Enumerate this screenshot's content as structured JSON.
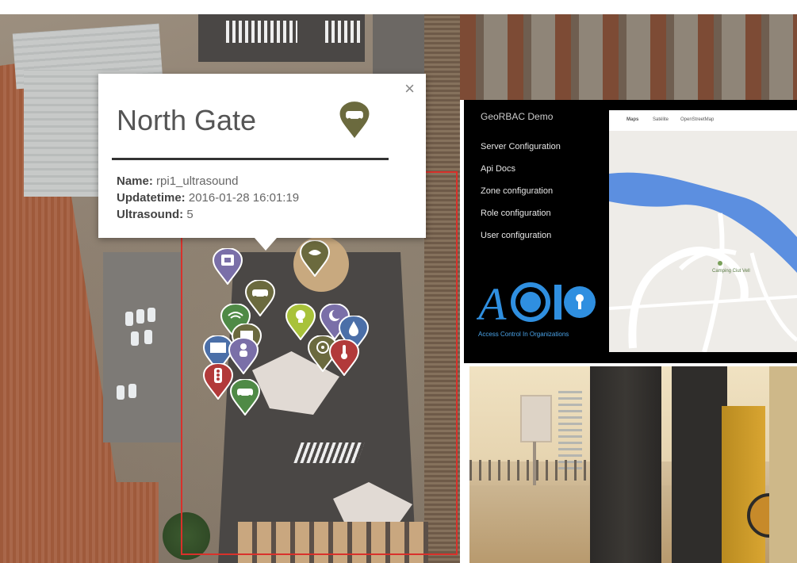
{
  "popup": {
    "title": "North Gate",
    "close": "×",
    "fields": [
      {
        "label": "Name:",
        "value": "rpi1_ultrasound"
      },
      {
        "label": "Updatetime:",
        "value": "2016-01-28 16:01:19"
      },
      {
        "label": "Ultrasound:",
        "value": "5"
      }
    ]
  },
  "panel": {
    "brand": "GeoRBAC Demo",
    "nav": [
      "Server Configuration",
      "Api Docs",
      "Zone configuration",
      "Role configuration",
      "User configuration"
    ],
    "logo_subtitle": "Access Control In Organizations"
  },
  "minimap": {
    "tabs": [
      "Maps",
      "Satélite",
      "OpenStreetMap"
    ],
    "place_label": "Camping Ciut Vell"
  },
  "colors": {
    "zone_border": "#d9312b",
    "marker_olive": "#6b6a3e",
    "marker_purple": "#7a6fa8",
    "marker_red": "#b23a3a",
    "marker_green": "#4f8a46",
    "marker_lime": "#a8c23a",
    "marker_blue": "#4b6fa8",
    "logo_blue": "#2f8fe0"
  },
  "markers": [
    {
      "icon": "printer-icon",
      "color": "#7a6fa8"
    },
    {
      "icon": "car-icon",
      "color": "#6b6a3e"
    },
    {
      "icon": "wifi-icon",
      "color": "#4f8a46"
    },
    {
      "icon": "sensor-icon",
      "color": "#6b6a3e"
    },
    {
      "icon": "bulb-icon",
      "color": "#a8c23a"
    },
    {
      "icon": "moon-icon",
      "color": "#7a6fa8"
    },
    {
      "icon": "drop-icon",
      "color": "#4b6fa8"
    },
    {
      "icon": "screen-icon",
      "color": "#4b6fa8"
    },
    {
      "icon": "person-icon",
      "color": "#7a6fa8"
    },
    {
      "icon": "fan-icon",
      "color": "#6b6a3e"
    },
    {
      "icon": "thermometer-icon",
      "color": "#b23a3a"
    },
    {
      "icon": "traffic-light-icon",
      "color": "#b23a3a"
    },
    {
      "icon": "car-icon",
      "color": "#4f8a46"
    },
    {
      "icon": "water-icon",
      "color": "#6b6a3e"
    }
  ]
}
